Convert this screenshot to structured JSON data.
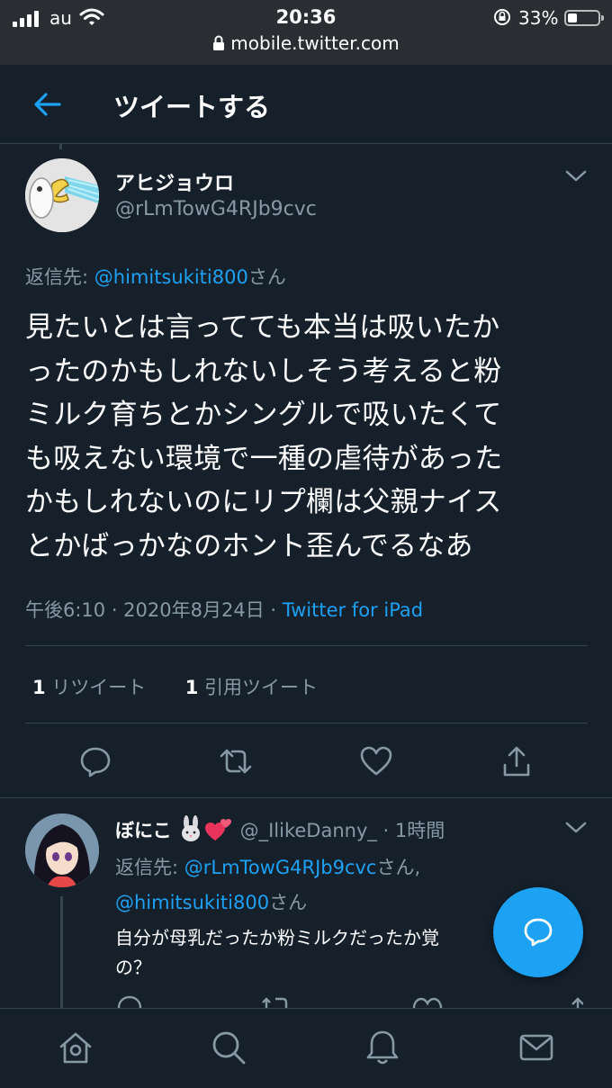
{
  "status_bar": {
    "carrier": "au",
    "time": "20:36",
    "battery": "33%",
    "url": "mobile.twitter.com"
  },
  "header": {
    "title": "ツイートする"
  },
  "tweet": {
    "display_name": "アヒジョウロ",
    "handle": "@rLmTowG4RJb9cvc",
    "reply_prefix": "返信先: ",
    "reply_to": "@himitsukiti800",
    "reply_suffix": "さん",
    "text_lines": [
      "見たいとは言ってても本当は吸いたか",
      "ったのかもしれないしそう考えると粉",
      "ミルク育ちとかシングルで吸いたくて",
      "も吸えない環境で一種の虐待があった",
      "かもしれないのにリプ欄は父親ナイス",
      "とかばっかなのホント歪んでるなあ"
    ],
    "timestamp": "午後6:10 · 2020年8月24日 · ",
    "source": "Twitter for iPad",
    "retweet_count": "1",
    "retweet_label": " リツイート",
    "quote_count": "1",
    "quote_label": " 引用ツイート"
  },
  "reply": {
    "display_name": "ぼにこ",
    "handle": "@_IlikeDanny_",
    "time": " · 1時間",
    "reply_prefix": "返信先: ",
    "reply_to_1": "@rLmTowG4RJb9cvc",
    "reply_mid": "さん,",
    "reply_to_2": "@himitsukiti800",
    "reply_suffix": "さん",
    "text_lines": [
      "自分が母乳だったか粉ミルクだったか覚",
      "の？"
    ]
  },
  "colors": {
    "background": "#15202b",
    "accent": "#1da1f2",
    "secondary_text": "#8899a6",
    "border": "#38444d"
  }
}
